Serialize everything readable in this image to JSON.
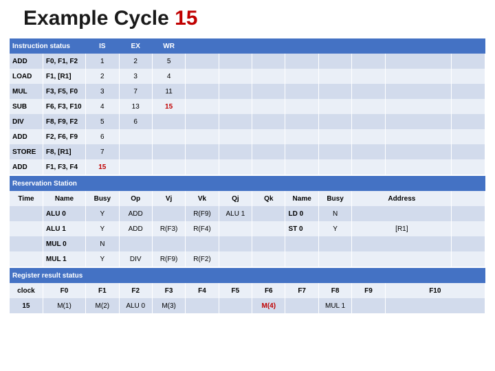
{
  "title_pre": "Example Cycle ",
  "title_accent": "15",
  "instr_header": {
    "label": "Instruction status",
    "cols": [
      "IS",
      "EX",
      "WR"
    ]
  },
  "instructions": [
    {
      "op": "ADD",
      "args": "F0, F1, F2",
      "is": "1",
      "ex": "2",
      "wr": "5",
      "wr_red": false
    },
    {
      "op": "LOAD",
      "args": "F1, [R1]",
      "is": "2",
      "ex": "3",
      "wr": "4",
      "wr_red": false
    },
    {
      "op": "MUL",
      "args": "F3, F5, F0",
      "is": "3",
      "ex": "7",
      "wr": "11",
      "wr_red": false
    },
    {
      "op": "SUB",
      "args": "F6, F3, F10",
      "is": "4",
      "ex": "13",
      "wr": "15",
      "wr_red": true
    },
    {
      "op": "DIV",
      "args": "F8, F9, F2",
      "is": "5",
      "ex": "6",
      "wr": "",
      "wr_red": false
    },
    {
      "op": "ADD",
      "args": "F2, F6, F9",
      "is": "6",
      "ex": "",
      "wr": "",
      "wr_red": false
    },
    {
      "op": "STORE",
      "args": "F8, [R1]",
      "is": "7",
      "ex": "",
      "wr": "",
      "wr_red": false
    },
    {
      "op": "ADD",
      "args": "F1, F3, F4",
      "is": "15",
      "is_red": true,
      "ex": "",
      "wr": "",
      "wr_red": false
    }
  ],
  "rs_header": {
    "label": "Reservation Station",
    "cols": [
      "Time",
      "Name",
      "Busy",
      "Op",
      "Vj",
      "Vk",
      "Qj",
      "Qk",
      "Name",
      "Busy",
      "Address"
    ]
  },
  "rs_rows": [
    {
      "time": "",
      "name": "ALU 0",
      "busy": "Y",
      "op": "ADD",
      "vj": "",
      "vk": "R(F9)",
      "qj": "ALU 1",
      "qk": "",
      "name2": "LD 0",
      "busy2": "N",
      "addr": ""
    },
    {
      "time": "",
      "name": "ALU 1",
      "busy": "Y",
      "op": "ADD",
      "vj": "R(F3)",
      "vk": "R(F4)",
      "qj": "",
      "qk": "",
      "name2": "ST 0",
      "busy2": "Y",
      "addr": "[R1]"
    },
    {
      "time": "",
      "name": "MUL 0",
      "busy": "N",
      "op": "",
      "vj": "",
      "vk": "",
      "qj": "",
      "qk": "",
      "name2": "",
      "busy2": "",
      "addr": ""
    },
    {
      "time": "",
      "name": "MUL 1",
      "busy": "Y",
      "op": "DIV",
      "vj": "R(F9)",
      "vk": "R(F2)",
      "qj": "",
      "qk": "",
      "name2": "",
      "busy2": "",
      "addr": ""
    }
  ],
  "reg_header": {
    "label": "Register result status",
    "cols": [
      "clock",
      "F0",
      "F1",
      "F2",
      "F3",
      "F4",
      "F5",
      "F6",
      "F7",
      "F8",
      "F9",
      "F10"
    ]
  },
  "reg_row": {
    "clock": "15",
    "vals": [
      "M(1)",
      "M(2)",
      "ALU 0",
      "M(3)",
      "",
      "",
      "M(4)",
      "",
      "MUL 1",
      "",
      ""
    ],
    "red_idx": [
      6
    ]
  }
}
